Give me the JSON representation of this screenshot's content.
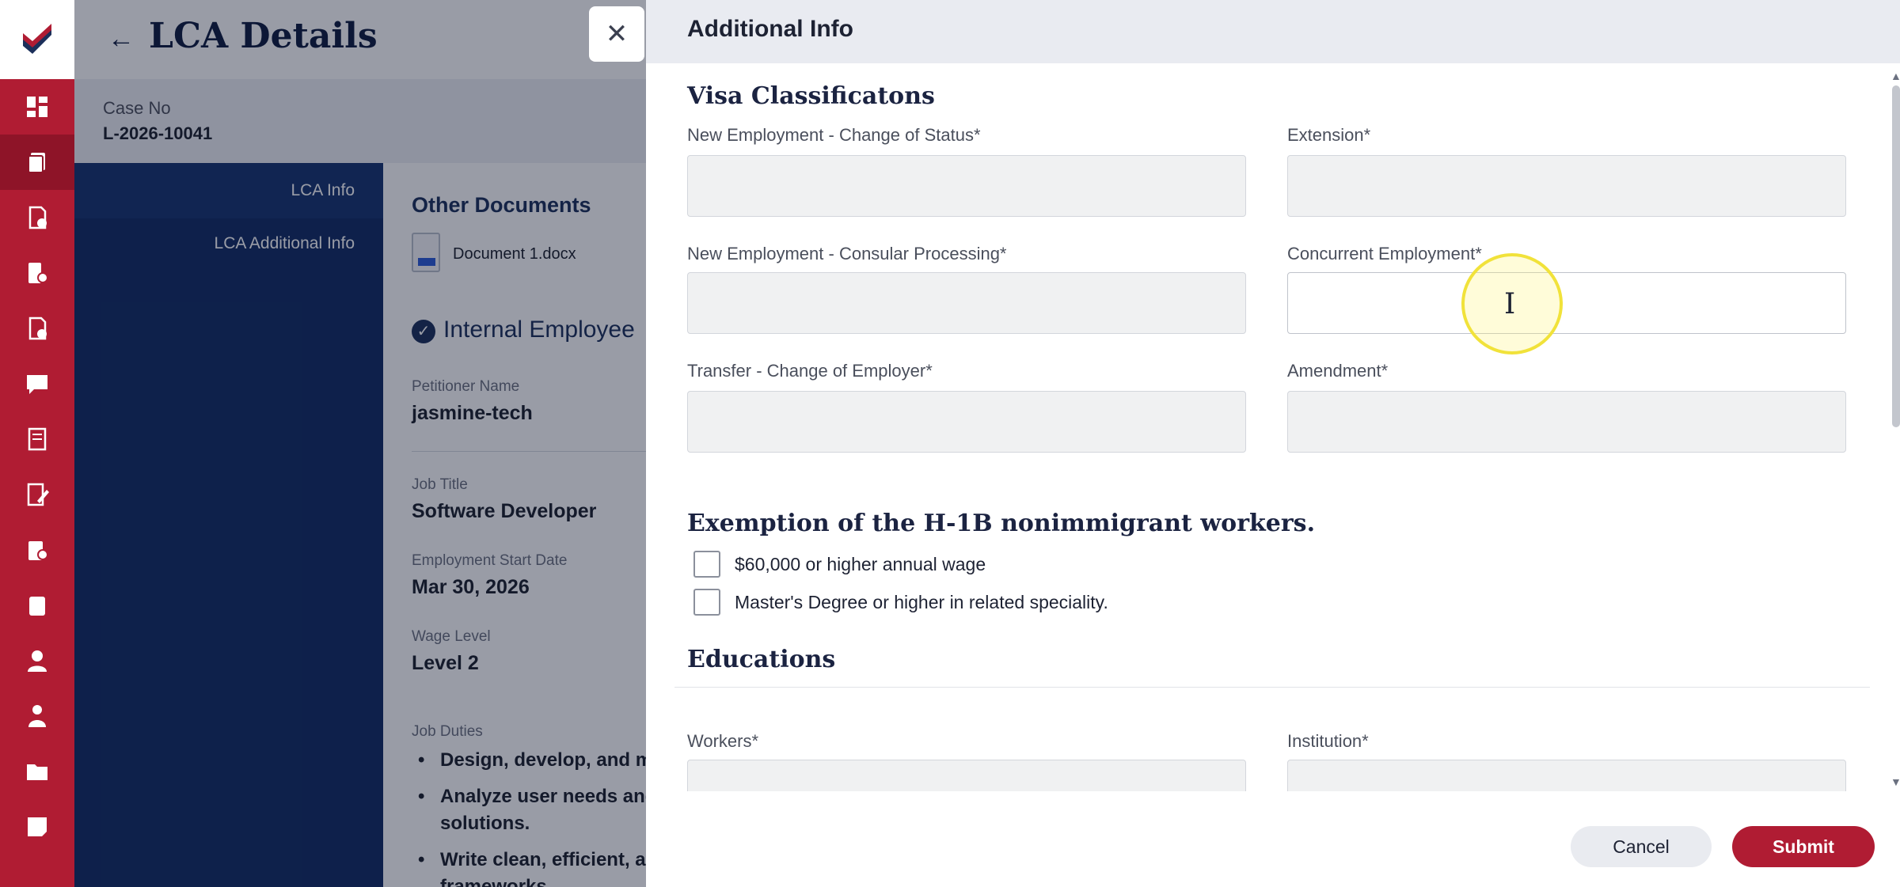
{
  "rail": {
    "items": [
      {
        "name": "dashboard-icon"
      },
      {
        "name": "documents-icon",
        "active": true
      },
      {
        "name": "approved-doc-icon"
      },
      {
        "name": "billing-icon"
      },
      {
        "name": "checked-doc-icon"
      },
      {
        "name": "chat-icon"
      },
      {
        "name": "ledger-icon"
      },
      {
        "name": "edit-doc-icon"
      },
      {
        "name": "settings-doc-icon"
      },
      {
        "name": "clipboard-check-icon"
      },
      {
        "name": "user-icon"
      },
      {
        "name": "team-icon"
      },
      {
        "name": "folder-icon"
      },
      {
        "name": "notes-icon"
      }
    ]
  },
  "page": {
    "title": "LCA Details",
    "back_icon": "arrow-left-icon",
    "case_label": "Case No",
    "case_value": "L-2026-10041",
    "tabs": [
      "LCA Info",
      "LCA Additional Info"
    ],
    "other_documents_heading": "Other Documents",
    "document_name": "Document 1.docx",
    "section_heading": "Internal Employee",
    "fields": [
      {
        "label": "Petitioner Name",
        "value": "jasmine-tech"
      },
      {
        "label": "Job Title",
        "value": "Software Developer"
      },
      {
        "label": "Employment Start Date",
        "value": "Mar 30, 2026"
      },
      {
        "label": "Wage Level",
        "value": "Level 2"
      }
    ],
    "job_duties_label": "Job Duties",
    "job_duties": [
      "Design, develop, and m",
      "Analyze user needs and solutions.",
      "Write clean, efficient, a frameworks."
    ]
  },
  "drawer": {
    "close_icon": "close-icon",
    "title": "Additional Info",
    "visa_heading": "Visa Classificatons",
    "visa_fields": [
      {
        "label": "New Employment - Change of Status*",
        "value": ""
      },
      {
        "label": "Extension*",
        "value": ""
      },
      {
        "label": "New Employment - Consular Processing*",
        "value": ""
      },
      {
        "label": "Concurrent Employment*",
        "value": ""
      },
      {
        "label": "Transfer - Change of Employer*",
        "value": ""
      },
      {
        "label": "Amendment*",
        "value": ""
      }
    ],
    "exemption_heading": "Exemption of the H-1B nonimmigrant workers.",
    "exemptions": [
      {
        "label": "$60,000 or higher annual wage",
        "checked": false
      },
      {
        "label": "Master's Degree or higher in related speciality.",
        "checked": false
      }
    ],
    "educations_heading": "Educations",
    "education_fields": [
      {
        "label": "Workers*",
        "value": ""
      },
      {
        "label": "Institution*",
        "value": ""
      }
    ],
    "cancel_label": "Cancel",
    "submit_label": "Submit"
  },
  "colors": {
    "brand": "#b01c33",
    "navy": "#102a62",
    "drawer_header": "#e9ebf1"
  }
}
